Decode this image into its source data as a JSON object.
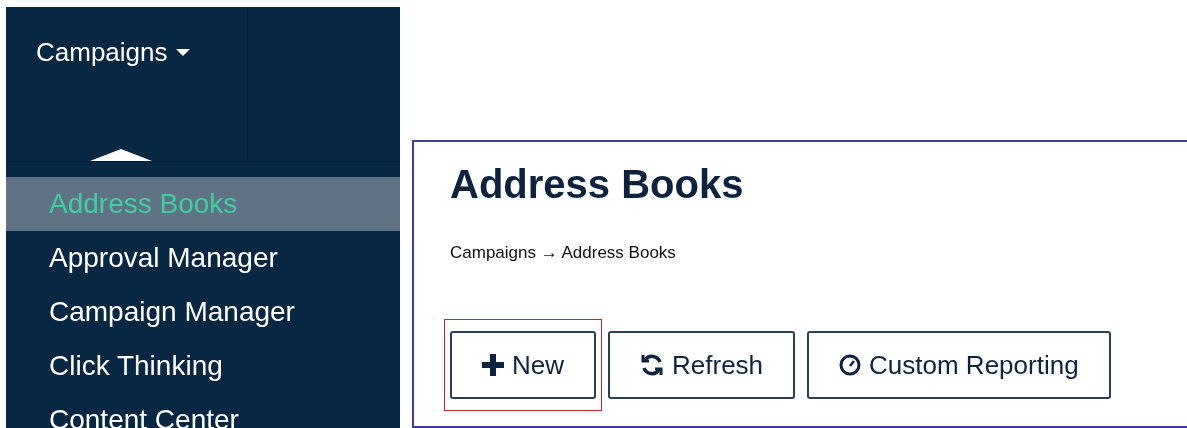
{
  "nav": {
    "label": "Campaigns",
    "expanded": true,
    "items": [
      {
        "label": "Address Books",
        "selected": true
      },
      {
        "label": "Approval Manager",
        "selected": false
      },
      {
        "label": "Campaign Manager",
        "selected": false
      },
      {
        "label": "Click Thinking",
        "selected": false
      },
      {
        "label": "Content Center",
        "selected": false
      }
    ]
  },
  "page": {
    "title": "Address Books",
    "breadcrumb": "Campaigns → Address Books",
    "buttons": [
      {
        "kind": "new",
        "label": "New",
        "highlighted": true
      },
      {
        "kind": "refresh",
        "label": "Refresh",
        "highlighted": false
      },
      {
        "kind": "report",
        "label": "Custom Reporting",
        "highlighted": false
      }
    ]
  }
}
